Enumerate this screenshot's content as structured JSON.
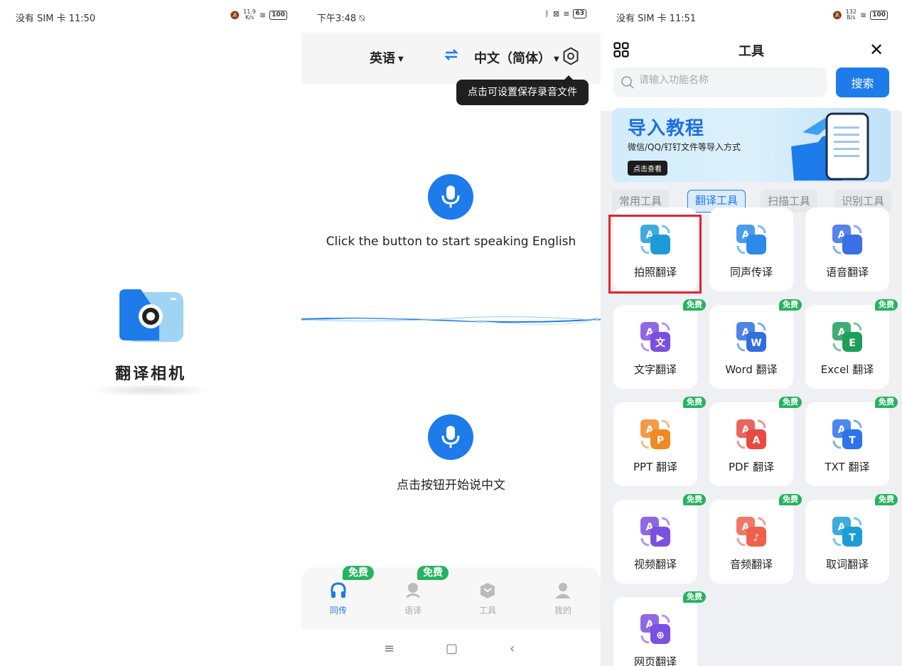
{
  "panel1": {
    "status": {
      "carrier_time": "没有 SIM 卡 11:50",
      "speed": "11.9",
      "speed_unit": "K/s",
      "battery": "100"
    },
    "app_name": "翻译相机"
  },
  "panel2": {
    "status": {
      "time": "下午3:48",
      "battery": "63"
    },
    "source_lang": "英语",
    "target_lang": "中文（简体）",
    "tooltip": "点击可设置保存录音文件",
    "prompt_en": "Click the button to start speaking English",
    "prompt_zh": "点击按钮开始说中文",
    "tabs": [
      {
        "label": "同传",
        "badge": "免费"
      },
      {
        "label": "语译",
        "badge": "免费"
      },
      {
        "label": "工具"
      },
      {
        "label": "我的"
      }
    ]
  },
  "panel3": {
    "status": {
      "carrier_time": "没有 SIM 卡 11:51",
      "speed": "132",
      "speed_unit": "B/s",
      "battery": "100"
    },
    "title": "工具",
    "search_placeholder": "请输入功能名称",
    "search_button": "搜索",
    "banner": {
      "title": "导入教程",
      "subtitle": "微信/QQ/钉钉文件等导入方式",
      "button": "点击查看"
    },
    "categories": [
      "常用工具",
      "翻译工具",
      "扫描工具",
      "识别工具"
    ],
    "tools": [
      {
        "label": "拍照翻译",
        "color": "#1e9bd7"
      },
      {
        "label": "同声传译",
        "color": "#2c8be8"
      },
      {
        "label": "语音翻译",
        "color": "#3a6fe6"
      },
      {
        "label": "文字翻译",
        "badge": "免费",
        "color": "#7b4fe0",
        "glyph": "文"
      },
      {
        "label": "Word 翻译",
        "badge": "免费",
        "color": "#2f6fe0",
        "glyph": "W"
      },
      {
        "label": "Excel 翻译",
        "badge": "免费",
        "color": "#1f9e5a",
        "glyph": "E"
      },
      {
        "label": "PPT 翻译",
        "badge": "免费",
        "color": "#f08a24",
        "glyph": "P"
      },
      {
        "label": "PDF 翻译",
        "badge": "免费",
        "color": "#e84a43",
        "glyph": "A"
      },
      {
        "label": "TXT 翻译",
        "badge": "免费",
        "color": "#2f72ea",
        "glyph": "T"
      },
      {
        "label": "视频翻译",
        "badge": "免费",
        "color": "#7b4fe0",
        "glyph": "▶"
      },
      {
        "label": "音频翻译",
        "badge": "免费",
        "color": "#f0604a",
        "glyph": "♪"
      },
      {
        "label": "取词翻译",
        "badge": "免费",
        "color": "#1a9ed8",
        "glyph": "T"
      },
      {
        "label": "网页翻译",
        "badge": "免费",
        "color": "#7b4fe0",
        "glyph": "⊕"
      }
    ]
  }
}
